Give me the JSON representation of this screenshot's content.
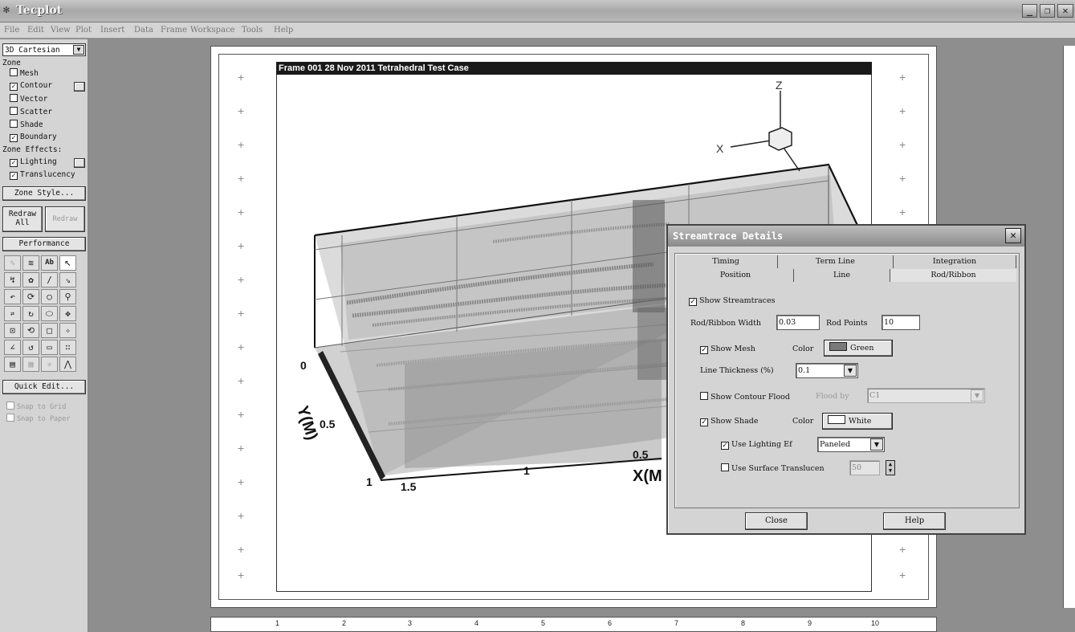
{
  "window": {
    "title": "Tecplot",
    "icon": "tecplot-logo-icon"
  },
  "menu": [
    "File",
    "Edit",
    "View",
    "Plot",
    "Insert",
    "Data",
    "Frame",
    "Workspace",
    "Tools",
    "Help"
  ],
  "sidebar": {
    "plot_type": "3D Cartesian",
    "zone_label": "Zone",
    "zone_layers": [
      {
        "label": "Mesh",
        "checked": false
      },
      {
        "label": "Contour",
        "checked": true
      },
      {
        "label": "Vector",
        "checked": false
      },
      {
        "label": "Scatter",
        "checked": false
      },
      {
        "label": "Shade",
        "checked": false
      },
      {
        "label": "Boundary",
        "checked": true
      }
    ],
    "zone_effects_label": "Zone Effects:",
    "zone_effects": [
      {
        "label": "Lighting",
        "checked": true
      },
      {
        "label": "Translucency",
        "checked": true
      }
    ],
    "zone_style_button": "Zone Style...",
    "redraw_all_line1": "Redraw",
    "redraw_all_line2": "All",
    "redraw_button": "Redraw",
    "performance_button": "Performance",
    "quick_edit_button": "Quick Edit...",
    "snap_to_grid": "Snap to Grid",
    "snap_to_paper": "Snap to Paper"
  },
  "frame": {
    "header": "Frame 001   28 Nov 2011   Tetrahedral Test Case",
    "axis_y_label": "Y(M)",
    "axis_x_label": "X(M",
    "y_ticks": [
      "0",
      "0.5",
      "1"
    ],
    "x_ticks": [
      "1.5",
      "1",
      "0.5"
    ],
    "orient_z": "Z",
    "orient_x": "X"
  },
  "ruler_bottom": [
    "1",
    "2",
    "3",
    "4",
    "5",
    "6",
    "7",
    "8",
    "9",
    "10"
  ],
  "dialog": {
    "title": "Streamtrace Details",
    "tabs_row1": [
      "Timing",
      "Term Line",
      "Integration"
    ],
    "tabs_row2": [
      "Position",
      "Line",
      "Rod/Ribbon"
    ],
    "active_tab": "Rod/Ribbon",
    "show_streamtraces": "Show Streamtraces",
    "rod_ribbon_width_label": "Rod/Ribbon Width",
    "rod_ribbon_width_value": "0.03",
    "rod_points_label": "Rod Points",
    "rod_points_value": "10",
    "show_mesh": "Show Mesh",
    "mesh_color_label": "Color",
    "mesh_color_value": "Green",
    "mesh_color_hex": "#7a7a7a",
    "line_thickness_label": "Line Thickness (%)",
    "line_thickness_value": "0.1",
    "show_contour_flood": "Show Contour Flood",
    "flood_by_label": "Flood by",
    "flood_by_value": "C1",
    "show_shade": "Show Shade",
    "shade_color_label": "Color",
    "shade_color_value": "White",
    "use_lighting_label": "Use Lighting Ef",
    "use_lighting_value": "Paneled",
    "use_translucency_label": "Use Surface Translucen",
    "use_translucency_value": "50",
    "close_button": "Close",
    "help_button": "Help"
  }
}
